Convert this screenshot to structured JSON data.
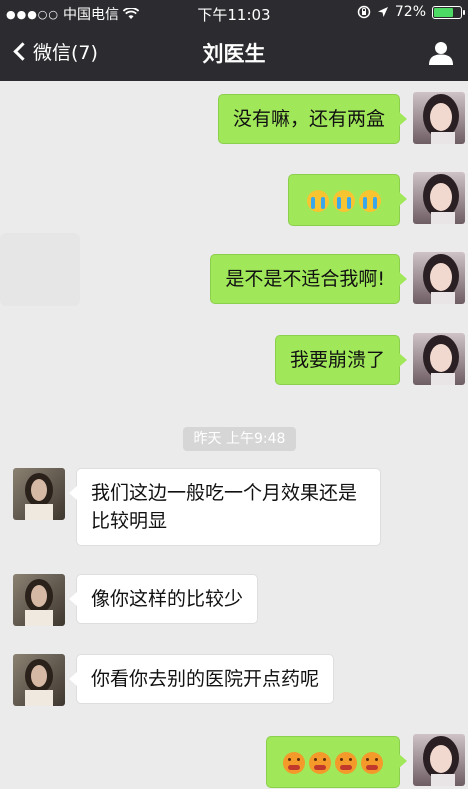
{
  "status_bar": {
    "signal_dots": "●●●○○",
    "carrier": "中国电信",
    "time": "下午11:03",
    "battery_text": "72%",
    "battery_level": 0.72
  },
  "nav": {
    "back_label": "微信(7)",
    "title": "刘医生"
  },
  "messages": [
    {
      "side": "right",
      "text": "没有嘛，还有两盒"
    },
    {
      "side": "right",
      "emojis": [
        "crying-emoji",
        "crying-emoji",
        "crying-emoji"
      ]
    },
    {
      "side": "right",
      "text": "是不是不适合我啊!"
    },
    {
      "side": "right",
      "text": "我要崩溃了"
    },
    {
      "side": "left",
      "text": "我们这边一般吃一个月效果还是比较明显"
    },
    {
      "side": "left",
      "text": "像你这样的比较少"
    },
    {
      "side": "left",
      "text": "你看你去别的医院开点药呢"
    },
    {
      "side": "right",
      "emojis": [
        "angry-emoji",
        "angry-emoji",
        "angry-emoji",
        "angry-emoji"
      ]
    }
  ],
  "timestamp": "昨天 上午9:48",
  "colors": {
    "header_bg": "#2c2c30",
    "chat_bg": "#ebebeb",
    "sent_bubble": "#a0e75a",
    "received_bubble": "#ffffff",
    "battery_fill": "#4cd964"
  }
}
